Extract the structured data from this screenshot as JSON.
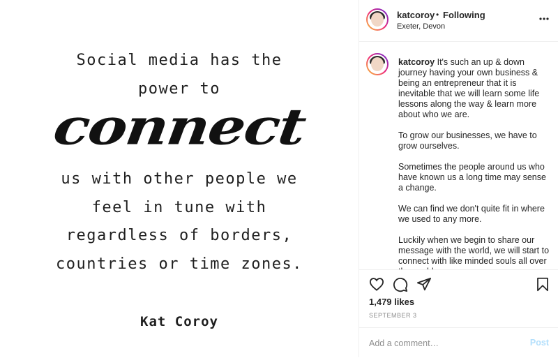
{
  "image": {
    "quote_top": [
      "Social media has the",
      "power to"
    ],
    "quote_highlight": "connect",
    "quote_bottom": [
      "us with other people we",
      "feel in tune with",
      "regardless of borders,",
      "countries or time zones."
    ],
    "author": "Kat Coroy"
  },
  "header": {
    "username": "katcoroy",
    "separator": "•",
    "follow_status": "Following",
    "location": "Exeter, Devon",
    "more_icon": "more-horizontal-icon"
  },
  "caption": {
    "username": "katcoroy",
    "paragraphs": [
      "It's such an up & down journey having your own business & being an entrepreneur that it is inevitable that we will learn some life lessons along the way & learn more about who we are.",
      "To grow our businesses, we have to grow ourselves.",
      "Sometimes the people around us who have known us a long time may sense a change.",
      "We can find we don't quite fit in where we used to any more.",
      "Luckily when we begin to share our message with the world, we will start to connect with like minded souls all over the world"
    ]
  },
  "actions": {
    "icons": [
      "heart-icon",
      "comment-icon",
      "share-icon",
      "bookmark-icon"
    ],
    "likes": "1,479 likes",
    "date": "SEPTEMBER 3"
  },
  "comment": {
    "placeholder": "Add a comment…",
    "post_label": "Post",
    "post_color": "#b2dffc"
  }
}
